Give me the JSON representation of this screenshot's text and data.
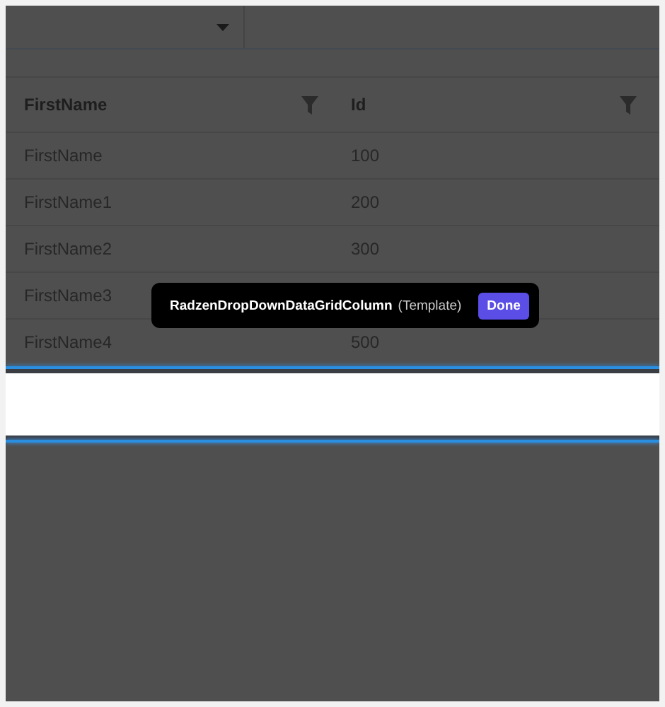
{
  "grid": {
    "columns": [
      {
        "title": "FirstName",
        "filterable": true
      },
      {
        "title": "Id",
        "filterable": true
      }
    ],
    "rows": [
      {
        "first_name": "FirstName",
        "id": "100"
      },
      {
        "first_name": "FirstName1",
        "id": "200"
      },
      {
        "first_name": "FirstName2",
        "id": "300"
      },
      {
        "first_name": "FirstName3"
      },
      {
        "first_name": "FirstName4",
        "id": "500"
      }
    ]
  },
  "selection_tooltip": {
    "component": "RadzenDropDownDataGridColumn",
    "tag": "(Template)",
    "button": "Done"
  }
}
